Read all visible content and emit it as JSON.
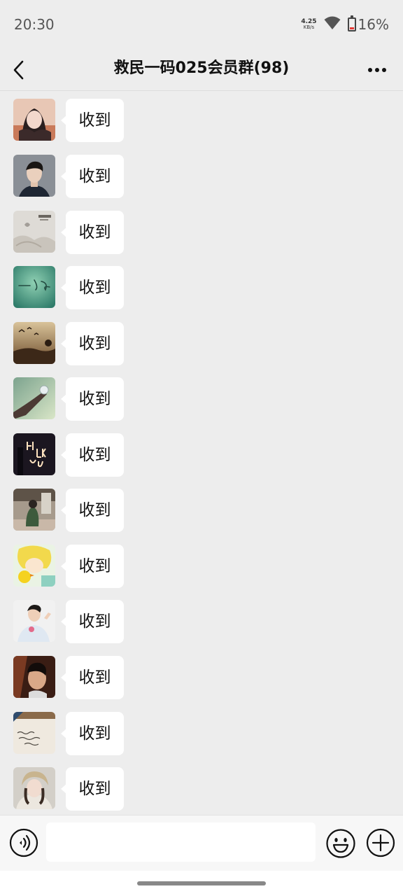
{
  "status_bar": {
    "time": "20:30",
    "net_speed_value": "4.25",
    "net_speed_unit": "KB/s",
    "battery_percent": "16%",
    "battery_color": "#e53935",
    "icons": [
      "wifi-icon",
      "battery-icon"
    ]
  },
  "header": {
    "title": "救民一码025会员群(98)",
    "back_icon": "chevron-left-icon",
    "more_icon": "more-dots-icon"
  },
  "messages": [
    {
      "text": "收到",
      "avatar": "avatar-girl-fox-filter"
    },
    {
      "text": "收到",
      "avatar": "avatar-man-portrait"
    },
    {
      "text": "收到",
      "avatar": "avatar-bedsheet-photo"
    },
    {
      "text": "收到",
      "avatar": "avatar-teal-handwriting"
    },
    {
      "text": "收到",
      "avatar": "avatar-sunset-birds"
    },
    {
      "text": "收到",
      "avatar": "avatar-hand-holding-glass"
    },
    {
      "text": "收到",
      "avatar": "avatar-neon-sign"
    },
    {
      "text": "收到",
      "avatar": "avatar-girl-sitting"
    },
    {
      "text": "收到",
      "avatar": "avatar-anime-boy-chick"
    },
    {
      "text": "收到",
      "avatar": "avatar-young-man-selfie"
    },
    {
      "text": "收到",
      "avatar": "avatar-man-dark"
    },
    {
      "text": "收到",
      "avatar": "avatar-paper-handwriting"
    },
    {
      "text": "收到",
      "avatar": "avatar-girl-cap"
    }
  ],
  "input_bar": {
    "placeholder": "",
    "value": "",
    "icons": [
      "voice-icon",
      "emoji-icon",
      "plus-icon"
    ]
  }
}
